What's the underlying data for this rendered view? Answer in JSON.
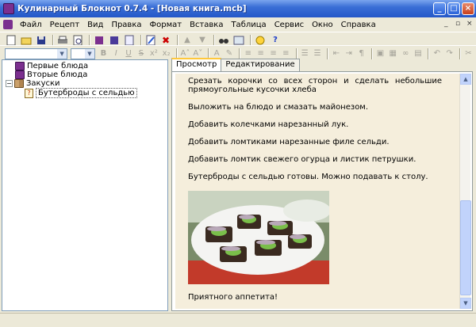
{
  "window": {
    "title": "Кулинарный Блокнот 0.7.4 - [Новая книга.mcb]"
  },
  "menu": {
    "items": [
      "Файл",
      "Рецепт",
      "Вид",
      "Правка",
      "Формат",
      "Вставка",
      "Таблица",
      "Сервис",
      "Окно",
      "Справка"
    ]
  },
  "tree": {
    "nodes": [
      {
        "label": "Первые блюда"
      },
      {
        "label": "Вторые блюда"
      },
      {
        "label": "Закуски"
      },
      {
        "label": "Бутерброды с сельдью"
      }
    ]
  },
  "tabs": {
    "view": "Просмотр",
    "edit": "Редактирование"
  },
  "recipe": {
    "paragraphs": [
      "Срезать корочки со всех сторон и сделать небольшие прямоугольные кусочки хлеба",
      "Выложить на блюдо и смазать майонезом.",
      "Добавить колечками нарезанный лук.",
      "Добавить ломтиками нарезанные филе сельди.",
      "Добавить ломтик свежего огурца и листик петрушки.",
      "Бутерброды с сельдью готовы. Можно подавать к столу.",
      "Приятного аппетита!"
    ]
  },
  "colors": {
    "viewer_bg": "#f5eedc",
    "book_purple": "#7b2f8f",
    "titlebar_blue": "#2457c8"
  }
}
